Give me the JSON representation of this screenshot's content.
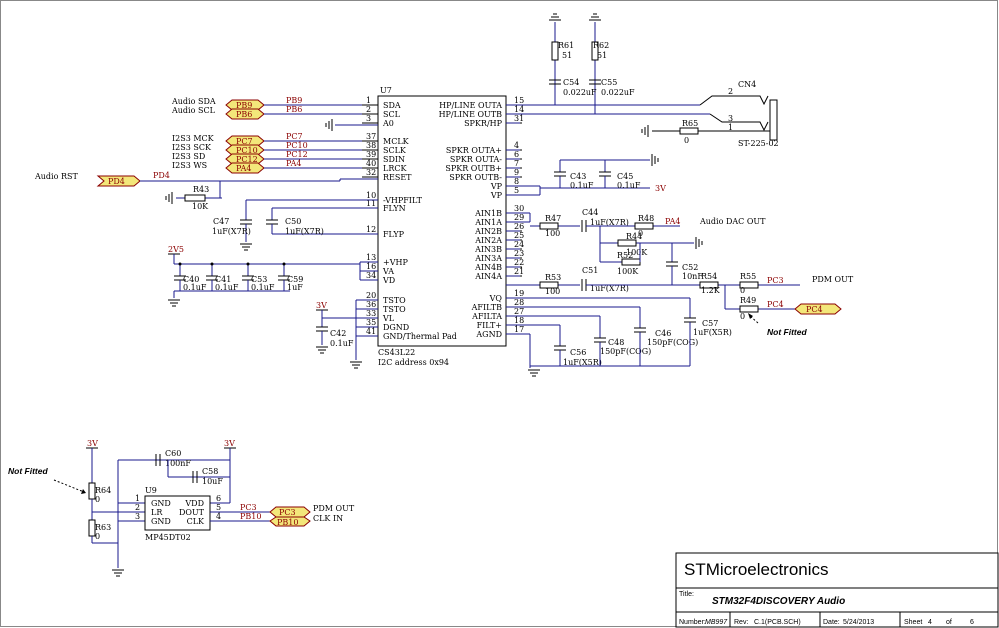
{
  "chip": {
    "ref": "U7",
    "part": "CS43L22",
    "note": "I2C address 0x94",
    "left_pins": [
      {
        "num": "1",
        "name": "SDA"
      },
      {
        "num": "2",
        "name": "SCL"
      },
      {
        "num": "3",
        "name": "A0"
      },
      {
        "num": "37",
        "name": "MCLK"
      },
      {
        "num": "38",
        "name": "SCLK"
      },
      {
        "num": "39",
        "name": "SDIN"
      },
      {
        "num": "40",
        "name": "LRCK"
      },
      {
        "num": "32",
        "name": "RESET"
      },
      {
        "num": "10",
        "name": "-VHPFILT"
      },
      {
        "num": "11",
        "name": "FLYN"
      },
      {
        "num": "12",
        "name": "FLYP"
      },
      {
        "num": "13",
        "name": "+VHP"
      },
      {
        "num": "16",
        "name": "VA"
      },
      {
        "num": "34",
        "name": "VD"
      },
      {
        "num": "20",
        "name": "TSTO"
      },
      {
        "num": "36",
        "name": "TSTO"
      },
      {
        "num": "33",
        "name": "VL"
      },
      {
        "num": "35",
        "name": "DGND"
      },
      {
        "num": "41",
        "name": "GND/Thermal Pad"
      }
    ],
    "right_pins": [
      {
        "num": "15",
        "name": "HP/LINE OUTA"
      },
      {
        "num": "14",
        "name": "HP/LINE OUTB"
      },
      {
        "num": "31",
        "name": "SPKR/HP"
      },
      {
        "num": "4",
        "name": "SPKR OUTA+"
      },
      {
        "num": "6",
        "name": "SPKR OUTA-"
      },
      {
        "num": "7",
        "name": "SPKR OUTB+"
      },
      {
        "num": "9",
        "name": "SPKR OUTB-"
      },
      {
        "num": "8",
        "name": "VP"
      },
      {
        "num": "5",
        "name": "VP"
      },
      {
        "num": "30",
        "name": "AIN1B"
      },
      {
        "num": "29",
        "name": "AIN1A"
      },
      {
        "num": "26",
        "name": "AIN2B"
      },
      {
        "num": "25",
        "name": "AIN2A"
      },
      {
        "num": "24",
        "name": "AIN3B"
      },
      {
        "num": "23",
        "name": "AIN3A"
      },
      {
        "num": "22",
        "name": "AIN4B"
      },
      {
        "num": "21",
        "name": "AIN4A"
      },
      {
        "num": "19",
        "name": "VQ"
      },
      {
        "num": "28",
        "name": "AFILTB"
      },
      {
        "num": "27",
        "name": "AFILTA"
      },
      {
        "num": "18",
        "name": "FILT+"
      },
      {
        "num": "17",
        "name": "AGND"
      }
    ]
  },
  "ports_left": [
    {
      "label": "Audio SDA",
      "port": "PB9",
      "net": "PB9"
    },
    {
      "label": "Audio SCL",
      "port": "PB6",
      "net": "PB6"
    },
    {
      "label": "I2S3 MCK",
      "port": "PC7",
      "net": "PC7"
    },
    {
      "label": "I2S3 SCK",
      "port": "PC10",
      "net": "PC10"
    },
    {
      "label": "I2S3 SD",
      "port": "PC12",
      "net": "PC12"
    },
    {
      "label": "I2S3 WS",
      "port": "PA4",
      "net": "PA4"
    }
  ],
  "reset": {
    "label": "Audio RST",
    "port": "PD4",
    "net": "PD4"
  },
  "components": {
    "r43": {
      "ref": "R43",
      "val": "10K"
    },
    "c47": {
      "ref": "C47",
      "val": "1uF(X7R)"
    },
    "c50": {
      "ref": "C50",
      "val": "1uF(X7R)"
    },
    "c40": {
      "ref": "C40",
      "val": "0.1uF"
    },
    "c41": {
      "ref": "C41",
      "val": "0.1uF"
    },
    "c53": {
      "ref": "C53",
      "val": "0.1uF"
    },
    "c59": {
      "ref": "C59",
      "val": "1uF"
    },
    "c42": {
      "ref": "C42",
      "val": "0.1uF"
    },
    "r61": {
      "ref": "R61",
      "val": "51"
    },
    "r62": {
      "ref": "R62",
      "val": "51"
    },
    "c54": {
      "ref": "C54",
      "val": "0.022uF"
    },
    "c55": {
      "ref": "C55",
      "val": "0.022uF"
    },
    "cn4": {
      "ref": "CN4",
      "val": "ST-225-02"
    },
    "r65": {
      "ref": "R65",
      "val": "0"
    },
    "c43": {
      "ref": "C43",
      "val": "0.1uF"
    },
    "c45": {
      "ref": "C45",
      "val": "0.1uF"
    },
    "r47": {
      "ref": "R47",
      "val": "100"
    },
    "c44": {
      "ref": "C44",
      "val": "1uF(X7R)"
    },
    "r48": {
      "ref": "R48",
      "val": "0"
    },
    "r44": {
      "ref": "R44",
      "val": "100K"
    },
    "r52": {
      "ref": "R52",
      "val": "100K"
    },
    "c52": {
      "ref": "C52",
      "val": "10nF"
    },
    "r54": {
      "ref": "R54",
      "val": "1.2K"
    },
    "r55": {
      "ref": "R55",
      "val": "0"
    },
    "r49": {
      "ref": "R49",
      "val": "0"
    },
    "r53": {
      "ref": "R53",
      "val": "100"
    },
    "c51": {
      "ref": "C51",
      "val": "1uF(X7R)"
    },
    "c56": {
      "ref": "C56",
      "val": "1uF(X5R)"
    },
    "c48": {
      "ref": "C48",
      "val": "150pF(COG)"
    },
    "c46": {
      "ref": "C46",
      "val": "150pF(COG)"
    },
    "c57": {
      "ref": "C57",
      "val": "1uF(X5R)"
    },
    "r64": {
      "ref": "R64",
      "val": "0"
    },
    "r63": {
      "ref": "R63",
      "val": "0"
    },
    "c60": {
      "ref": "C60",
      "val": "100nF"
    },
    "c58": {
      "ref": "C58",
      "val": "10uF"
    }
  },
  "power": {
    "v3": "3V",
    "v25": "2V5"
  },
  "nets": {
    "pa4": "PA4",
    "pc3": "PC3",
    "pc4": "PC4",
    "pb10": "PB10"
  },
  "texts": {
    "audio_dac_out": "Audio DAC OUT",
    "pdm_out": "PDM OUT",
    "not_fitted": "Not Fitted",
    "pdm_out2": "PDM OUT",
    "clk_in": "CLK IN"
  },
  "mic": {
    "ref": "U9",
    "part": "MP45DT02",
    "pins": [
      {
        "num": "1",
        "name": "GND"
      },
      {
        "num": "2",
        "name": "LR"
      },
      {
        "num": "3",
        "name": "GND"
      },
      {
        "num": "6",
        "name": "VDD"
      },
      {
        "num": "5",
        "name": "DOUT"
      },
      {
        "num": "4",
        "name": "CLK"
      }
    ],
    "ports": [
      {
        "port": "PC3",
        "net": "PC3"
      },
      {
        "port": "PB10",
        "net": "PB10"
      }
    ]
  },
  "cn4_pins": {
    "p2": "2",
    "p3": "3",
    "p1": "1"
  },
  "title_block": {
    "company": "STMicroelectronics",
    "title_label": "Title:",
    "title": "STM32F4DISCOVERY Audio",
    "number_label": "Number:",
    "number": "MB997",
    "rev_label": "Rev:",
    "rev": "C.1(PCB.SCH)",
    "date_label": "Date:",
    "date": "5/24/2013",
    "sheet_label": "Sheet",
    "sheet": "4",
    "of_label": "of",
    "total": "6"
  }
}
